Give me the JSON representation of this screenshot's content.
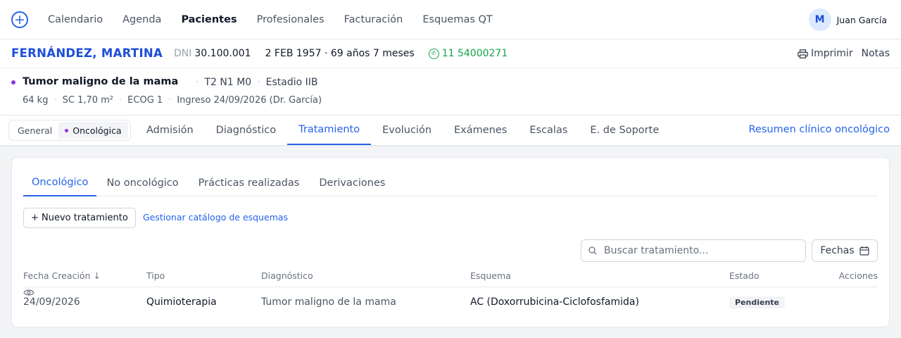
{
  "nav": {
    "items": [
      "Calendario",
      "Agenda",
      "Pacientes",
      "Profesionales",
      "Facturación",
      "Esquemas QT"
    ],
    "active": "Pacientes",
    "user": {
      "initial": "M",
      "name": "Juan García"
    }
  },
  "patient": {
    "name": "FERNÁNDEZ, MARTINA",
    "dni_label": "DNI",
    "dni": "30.100.001",
    "birth_age": "2 FEB 1957 · 69 años 7 meses",
    "phone": "11 54000271",
    "print_label": "Imprimir",
    "notes_label": "Notas"
  },
  "diagnosis": {
    "title": "Tumor maligno de la mama",
    "tnm": "T2 N1 M0",
    "stage": "Estadio IIB",
    "weight": "64 kg",
    "sc": "SC 1,70 m²",
    "ecog": "ECOG 1",
    "ingreso": "Ingreso 24/09/2026 (Dr. García)"
  },
  "toggle": {
    "general": "General",
    "oncologica": "Oncológica"
  },
  "tabs": [
    "Admisión",
    "Diagnóstico",
    "Tratamiento",
    "Evolución",
    "Exámenes",
    "Escalas",
    "E. de Soporte"
  ],
  "active_tab": "Tratamiento",
  "resumen_link": "Resumen clínico oncológico",
  "subtabs": [
    "Oncológico",
    "No oncológico",
    "Prácticas realizadas",
    "Derivaciones"
  ],
  "active_subtab": "Oncológico",
  "actions": {
    "new_treatment": "+ Nuevo tratamiento",
    "catalog_link": "Gestionar catálogo de esquemas",
    "search_placeholder": "Buscar tratamiento...",
    "dates_label": "Fechas"
  },
  "table": {
    "headers": [
      "Fecha Creación ↓",
      "Tipo",
      "Diagnóstico",
      "Esquema",
      "Estado",
      "Acciones"
    ],
    "rows": [
      {
        "fecha": "24/09/2026",
        "tipo": "Quimioterapia",
        "diagnostico": "Tumor maligno de la mama",
        "esquema": "AC (Doxorrubicina-Ciclofosfamida)",
        "estado": "Pendiente"
      }
    ]
  },
  "colors": {
    "accent": "#2563eb",
    "brand_name": "#1d4ed8",
    "whatsapp": "#16a34a",
    "oncology_dot": "#9333ea"
  },
  "icons": [
    "add-circle-icon",
    "whatsapp-icon",
    "printer-icon",
    "search-icon",
    "calendar-icon",
    "eye-icon"
  ]
}
